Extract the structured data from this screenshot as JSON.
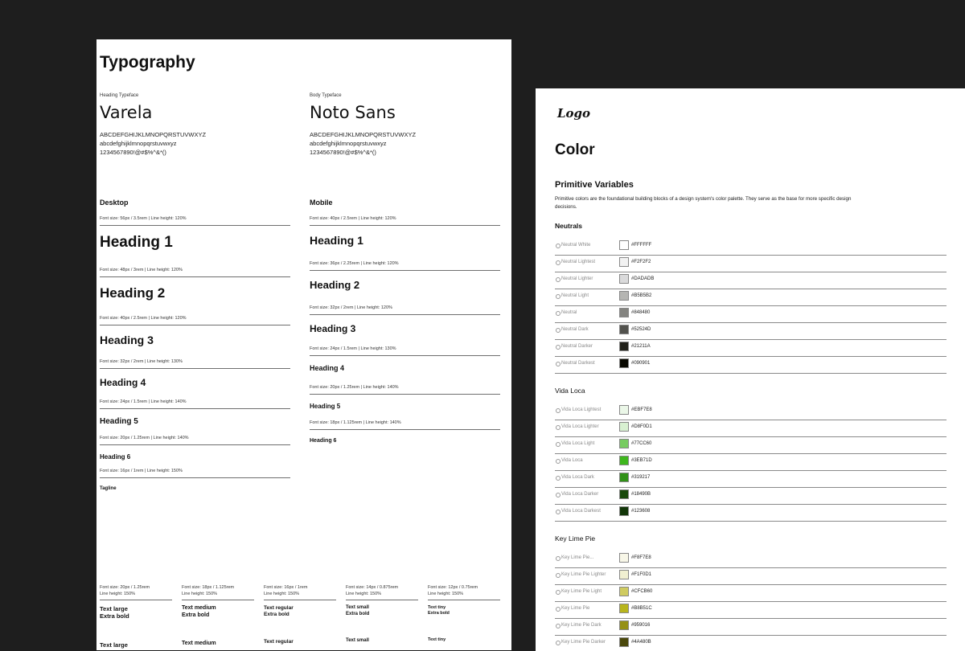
{
  "typography": {
    "title": "Typography",
    "heading_face": {
      "kicker": "Heading Typeface",
      "name": "Varela",
      "chars": "ABCDEFGHIJKLMNOPQRSTUVWXYZ\nabcdefghijklmnopqrstuvwxyz\n1234567890!@#$%^&*()"
    },
    "body_face": {
      "kicker": "Body Typeface",
      "name": "Noto Sans",
      "chars": "ABCDEFGHIJKLMNOPQRSTUVWXYZ\nabcdefghijklmnopqrstuvwxyz\n1234567890!@#$%^&*()"
    },
    "desktop": {
      "label": "Desktop",
      "rows": [
        {
          "meta": "Font size: 56px / 3.5rem | Line height: 120%",
          "sample": "Heading 1"
        },
        {
          "meta": "Font size: 48px / 3rem | Line height: 120%",
          "sample": "Heading 2"
        },
        {
          "meta": "Font size: 40px / 2.5rem | Line height: 120%",
          "sample": "Heading 3"
        },
        {
          "meta": "Font size: 32px / 2rem | Line height: 130%",
          "sample": "Heading 4"
        },
        {
          "meta": "Font size: 24px / 1.5rem | Line height: 140%",
          "sample": "Heading 5"
        },
        {
          "meta": "Font size: 20px / 1.25rem | Line height: 140%",
          "sample": "Heading 6"
        },
        {
          "meta": "Font size: 16px / 1rem | Line height: 150%",
          "sample": "Tagline"
        }
      ]
    },
    "mobile": {
      "label": "Mobile",
      "rows": [
        {
          "meta": "Font size: 40px / 2.5rem | Line height: 120%",
          "sample": "Heading 1"
        },
        {
          "meta": "Font size: 36px / 2.25rem | Line height: 120%",
          "sample": "Heading 2"
        },
        {
          "meta": "Font size: 32px / 2rem | Line height: 120%",
          "sample": "Heading 3"
        },
        {
          "meta": "Font size: 24px / 1.5rem | Line height: 130%",
          "sample": "Heading 4"
        },
        {
          "meta": "Font size: 20px / 1.25rem | Line height: 140%",
          "sample": "Heading 5"
        },
        {
          "meta": "Font size: 18px / 1.125rem | Line height: 140%",
          "sample": "Heading 6"
        }
      ]
    },
    "text_styles": [
      {
        "meta": "Font size: 20px / 1.25rem\nLine height: 150%",
        "sample": "Text large\nExtra bold",
        "repeat": "Text large"
      },
      {
        "meta": "Font size: 18px / 1.125rem\nLine height: 150%",
        "sample": "Text medium\nExtra bold",
        "repeat": "Text medium"
      },
      {
        "meta": "Font size: 16px / 1rem\nLine height: 150%",
        "sample": "Text regular\nExtra bold",
        "repeat": "Text regular"
      },
      {
        "meta": "Font size: 14px / 0.875rem\nLine height: 150%",
        "sample": "Text small\nExtra bold",
        "repeat": "Text small"
      },
      {
        "meta": "Font size: 12px / 0.75rem\nLine height: 150%",
        "sample": "Text tiny\nExtra bold",
        "repeat": "Text tiny"
      }
    ]
  },
  "color": {
    "logo": "Logo",
    "title": "Color",
    "primitive_title": "Primitive Variables",
    "primitive_desc": "Primitive colors are the foundational building blocks of a design system's color palette. They serve as the base for more specific design decisions.",
    "groups": [
      {
        "title": "Neutrals",
        "bold": true,
        "swatches": [
          {
            "name": "Neutral White",
            "hex": "#FFFFFF"
          },
          {
            "name": "Neutral Lightest",
            "hex": "#F2F2F2"
          },
          {
            "name": "Neutral Lighter",
            "hex": "#DADADB"
          },
          {
            "name": "Neutral Light",
            "hex": "#B5B5B2"
          },
          {
            "name": "Neutral",
            "hex": "#848480"
          },
          {
            "name": "Neutral Dark",
            "hex": "#52524D"
          },
          {
            "name": "Neutral Darker",
            "hex": "#21211A"
          },
          {
            "name": "Neutral Darkest",
            "hex": "#090901"
          }
        ]
      },
      {
        "title": "Vida Loca",
        "bold": false,
        "swatches": [
          {
            "name": "Vida Loca Lightest",
            "hex": "#EBF7E8"
          },
          {
            "name": "Vida Loca Lighter",
            "hex": "#D8F0D1"
          },
          {
            "name": "Vida Loca Light",
            "hex": "#77CC60"
          },
          {
            "name": "Vida Loca",
            "hex": "#3EB71D"
          },
          {
            "name": "Vida Loca Dark",
            "hex": "#319217"
          },
          {
            "name": "Vida Loca Darker",
            "hex": "#18490B"
          },
          {
            "name": "Vida Loca Darkest",
            "hex": "#123608"
          }
        ]
      },
      {
        "title": "Key Lime Pie",
        "bold": false,
        "swatches": [
          {
            "name": "Key Lime Pie...",
            "hex": "#F8F7E8"
          },
          {
            "name": "Key Lime Pie Lighter",
            "hex": "#F1F0D1"
          },
          {
            "name": "Key Lime Pie Light",
            "hex": "#CFCB60"
          },
          {
            "name": "Key Lime Pie",
            "hex": "#B8B51C"
          },
          {
            "name": "Key Lime Pie Dark",
            "hex": "#959016"
          },
          {
            "name": "Key Lime Pie Darker",
            "hex": "#4A480B"
          }
        ]
      }
    ]
  }
}
